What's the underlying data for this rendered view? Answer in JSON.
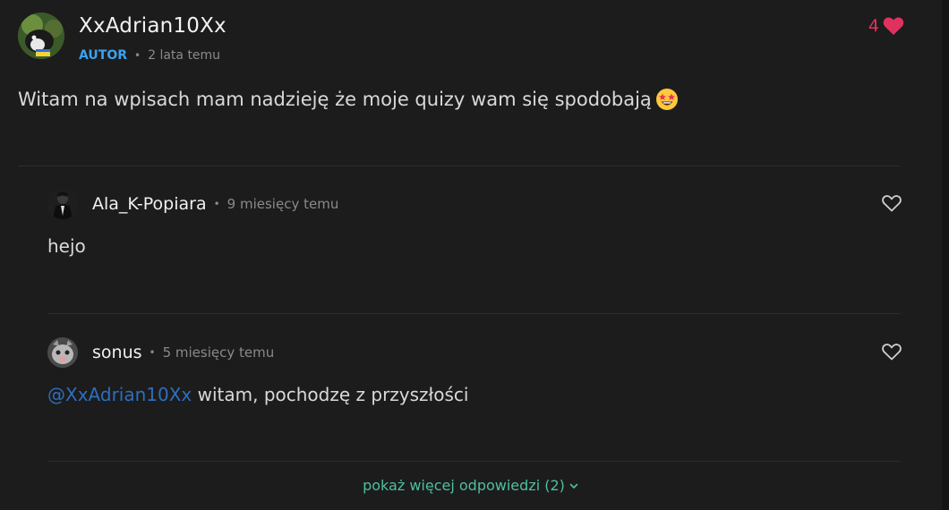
{
  "post": {
    "author": "XxAdrian10Xx",
    "badge": "AUTOR",
    "meta_separator": "•",
    "time": "2 lata temu",
    "likes": "4",
    "body": "Witam na wpisach mam nadzieję że moje quizy wam się spodobają",
    "body_emoji_icon": "star-struck-emoji-icon",
    "colors": {
      "background": "#1c1c1c",
      "badge": "#3aa3f0",
      "like": "#e0325e",
      "mention": "#2c6fbf",
      "show_more": "#4fbfa0"
    }
  },
  "replies": [
    {
      "author": "Ala_K-Popiara",
      "separator": "•",
      "time": "9 miesięcy temu",
      "mention": "",
      "body": "hejo"
    },
    {
      "author": "sonus",
      "separator": "•",
      "time": "5 miesięcy temu",
      "mention": "@XxAdrian10Xx",
      "body": " witam, pochodzę z przyszłości"
    }
  ],
  "show_more": {
    "label": "pokaż więcej odpowiedzi (2)",
    "icon": "chevron-down-icon"
  }
}
